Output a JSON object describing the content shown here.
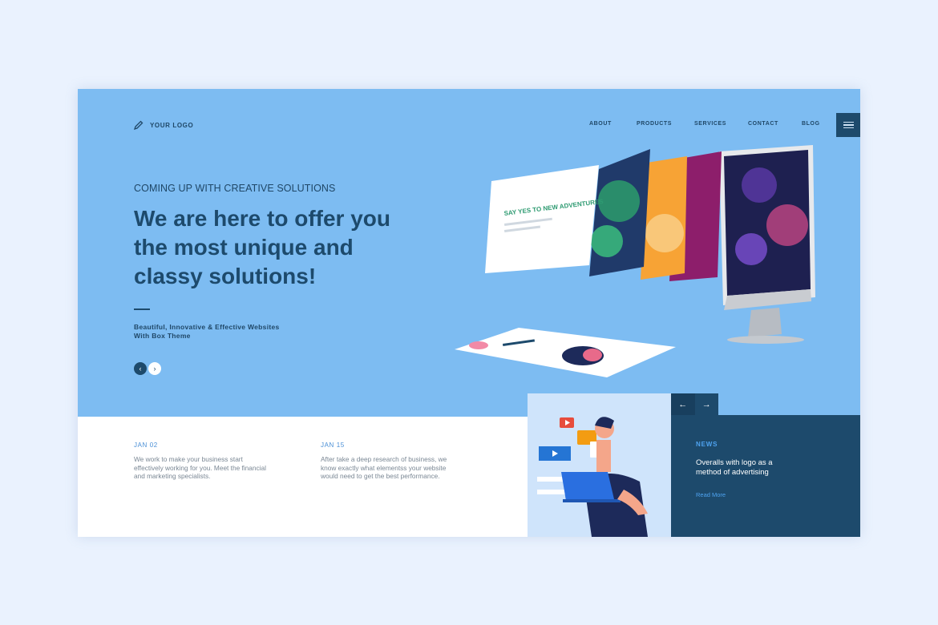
{
  "header": {
    "logo_text": "YOUR LOGO",
    "nav": [
      "ABOUT",
      "PRODUCTS",
      "SERVICES",
      "CONTACT",
      "BLOG"
    ]
  },
  "hero": {
    "eyebrow": "COMING UP WITH CREATIVE SOLUTIONS",
    "headline": "We are here to offer you the most unique and classy solutions!",
    "subtitle": "Beautiful, Innovative & Effective Websites With Box Theme",
    "mockup_card_title": "SAY YES TO NEW ADVENTURES"
  },
  "posts": [
    {
      "date": "JAN 02",
      "text": "We work to make your business start effectively working for you. Meet the financial and marketing specialists."
    },
    {
      "date": "JAN 15",
      "text": "After take a deep research of business, we know exactly what elementss your website would need to get the best performance."
    }
  ],
  "news": {
    "tag": "NEWS",
    "title": "Overalls with logo as a method of advertising",
    "link": "Read More"
  },
  "colors": {
    "hero_bg": "#7dbcf2",
    "dark_navy": "#1d4a6c",
    "accent_blue": "#4ea3f0"
  }
}
